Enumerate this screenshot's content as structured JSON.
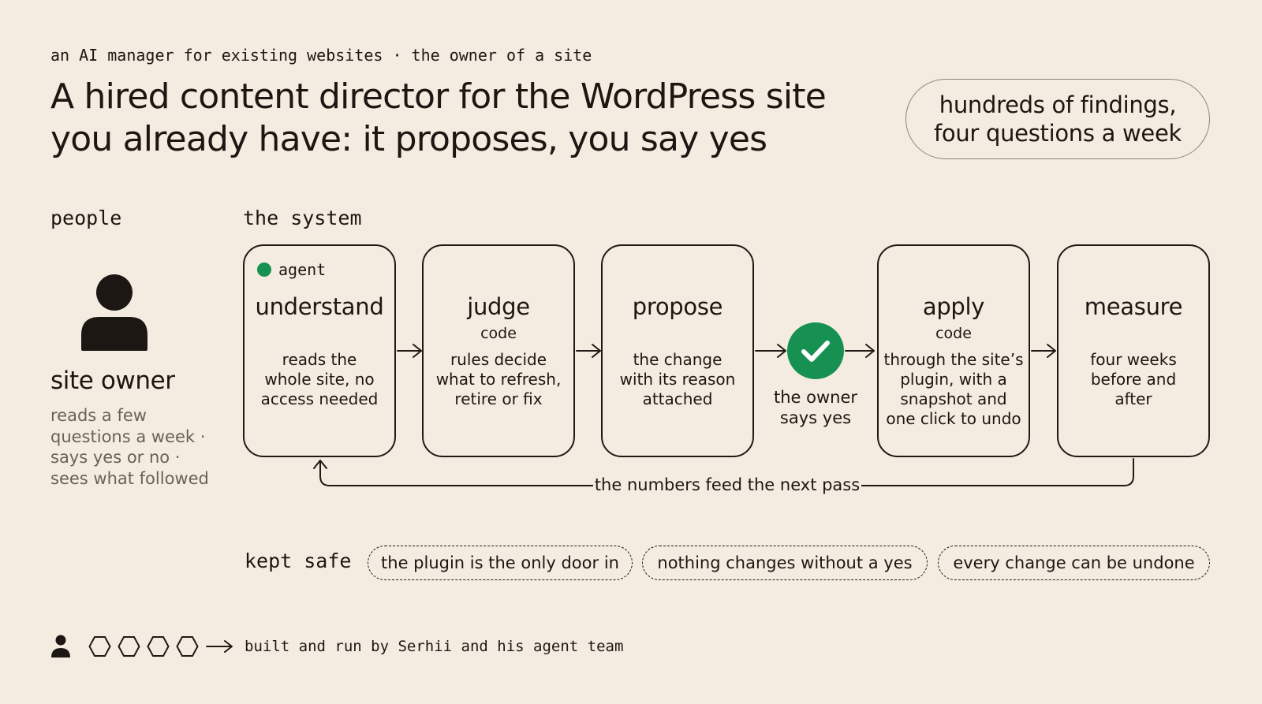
{
  "header": {
    "eyebrow": "an AI manager for existing websites · the owner of a site",
    "title_line1": "A hired content director for the WordPress site",
    "title_line2": "you already have: it proposes, you say yes",
    "pill_line1": "hundreds of findings,",
    "pill_line2": "four questions a week"
  },
  "people": {
    "label": "people",
    "name": "site owner",
    "desc": [
      "reads a few",
      "questions a week ·",
      "says yes or no ·",
      "sees what followed"
    ]
  },
  "system": {
    "label": "the system",
    "agent_tag": "agent",
    "steps": [
      {
        "title": "understand",
        "sub": "",
        "desc": [
          "reads the",
          "whole site, no",
          "access needed"
        ]
      },
      {
        "title": "judge",
        "sub": "code",
        "desc": [
          "rules decide",
          "what to refresh,",
          "retire or fix"
        ]
      },
      {
        "title": "propose",
        "sub": "",
        "desc": [
          "the change",
          "with its reason",
          "attached"
        ]
      },
      {
        "title": "apply",
        "sub": "code",
        "desc": [
          "through the site’s",
          "plugin, with a",
          "snapshot and",
          "one click to undo"
        ]
      },
      {
        "title": "measure",
        "sub": "",
        "desc": [
          "four weeks",
          "before and",
          "after"
        ]
      }
    ],
    "approval": [
      "the owner",
      "says yes"
    ],
    "loop_label": "the numbers feed the next pass"
  },
  "safety": {
    "label": "kept safe",
    "chips": [
      "the plugin is the only door in",
      "nothing changes without a yes",
      "every change can be undone"
    ]
  },
  "footer": {
    "text": "built and run by Serhii and his agent team"
  },
  "colors": {
    "background": "#f4ece0",
    "ink": "#1c1712",
    "accent_green": "#169152",
    "muted_text": "#6a6157"
  }
}
